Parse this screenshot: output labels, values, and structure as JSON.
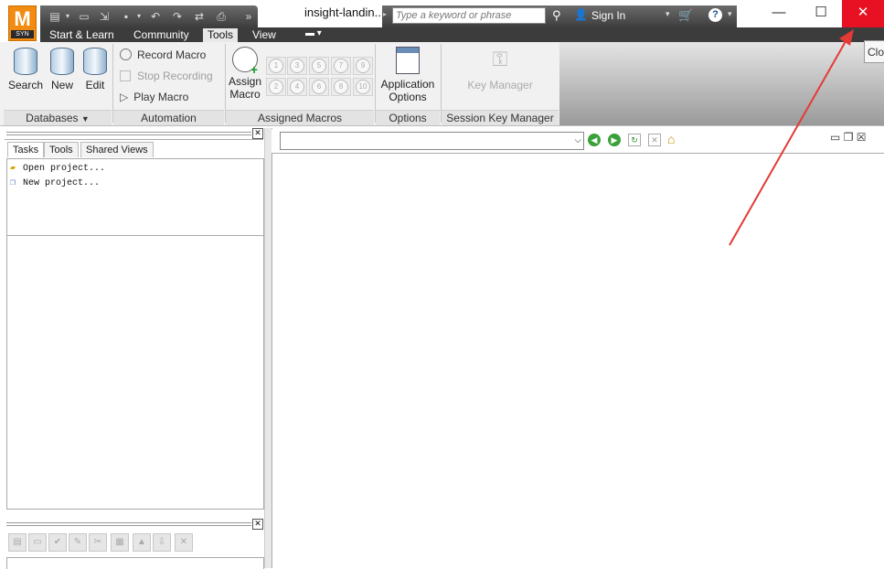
{
  "app": {
    "logo_letter": "M",
    "logo_sub": "SYN",
    "doc_title": "insight-landin..."
  },
  "search": {
    "placeholder": "Type a keyword or phrase"
  },
  "account": {
    "sign_in": "Sign In"
  },
  "window": {
    "close_tooltip": "Clo"
  },
  "tabs": [
    {
      "label": "Start & Learn"
    },
    {
      "label": "Community"
    },
    {
      "label": "Tools"
    },
    {
      "label": "View"
    }
  ],
  "ribbon": {
    "databases": {
      "label": "Databases",
      "search": "Search",
      "new": "New",
      "edit": "Edit"
    },
    "automation": {
      "label": "Automation",
      "record": "Record Macro",
      "stop": "Stop Recording",
      "play": "Play Macro"
    },
    "assigned": {
      "label": "Assigned Macros",
      "assign_line1": "Assign",
      "assign_line2": "Macro",
      "numbers": [
        "1",
        "3",
        "5",
        "7",
        "9",
        "2",
        "4",
        "6",
        "8",
        "10"
      ]
    },
    "options": {
      "label": "Options",
      "app_line1": "Application",
      "app_line2": "Options"
    },
    "session": {
      "label": "Session Key Manager",
      "key_manager": "Key Manager"
    }
  },
  "left_panel": {
    "tabs": [
      "Tasks",
      "Tools",
      "Shared Views"
    ],
    "tasks": [
      "Open project...",
      "New project..."
    ]
  },
  "colors": {
    "close_red": "#e81123",
    "logo_orange": "#f18b12",
    "tab_bar": "#3c3c3c",
    "arrow_red": "#e53935"
  }
}
